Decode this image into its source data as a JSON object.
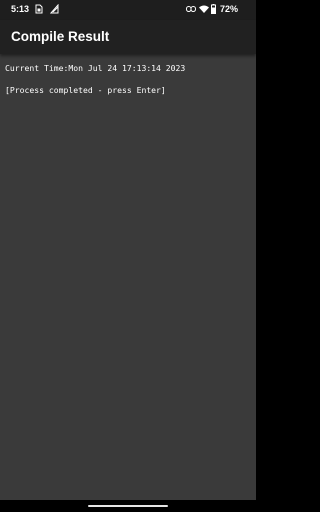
{
  "status_bar": {
    "time": "5:13",
    "battery_percent": "72%",
    "icons": [
      "sim-card-icon",
      "signal-check-icon",
      "link-icon",
      "wifi-icon",
      "battery-icon"
    ]
  },
  "app_bar": {
    "title": "Compile Result"
  },
  "console": {
    "lines": [
      "Current Time:Mon Jul 24 17:13:14 2023",
      "[Process completed - press Enter]"
    ]
  },
  "colors": {
    "status_bar_bg": "#1e1e1e",
    "app_bar_bg": "#212121",
    "content_bg": "#3a3a3a",
    "text": "#ffffff"
  }
}
